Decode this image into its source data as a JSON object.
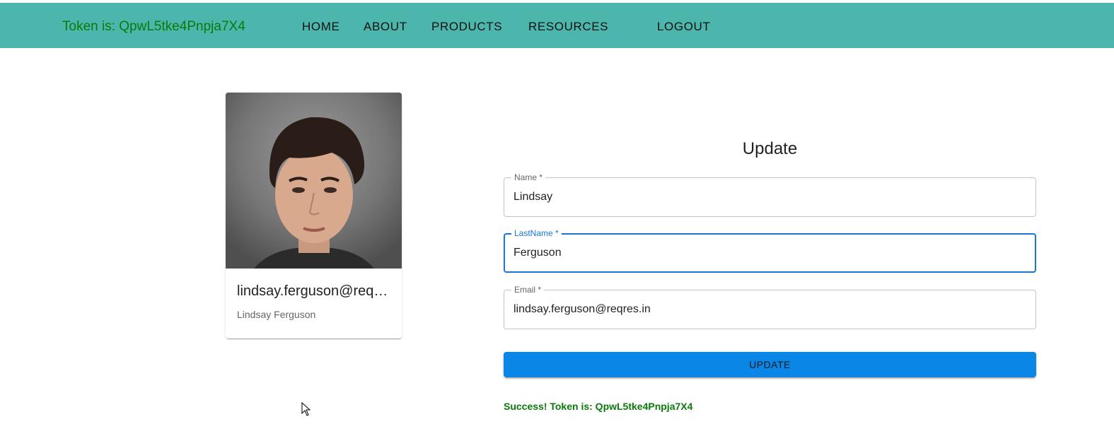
{
  "header": {
    "token_text": "Token is: QpwL5tke4Pnpja7X4",
    "nav": {
      "home": "HOME",
      "about": "ABOUT",
      "products": "PRODUCTS",
      "resources": "RESOURCES",
      "logout": "LOGOUT"
    },
    "background_color": "#4db6ac",
    "token_color": "#0a7a0a"
  },
  "profile_card": {
    "email": "lindsay.ferguson@reqres.in",
    "full_name": "Lindsay Ferguson",
    "avatar": "user-photo"
  },
  "form": {
    "title": "Update",
    "fields": [
      {
        "label": "Name *",
        "value": "Lindsay"
      },
      {
        "label": "LastName *",
        "value": "Ferguson"
      },
      {
        "label": "Email *",
        "value": "lindsay.ferguson@reqres.in"
      }
    ],
    "focus_color": "#1976d2",
    "submit_label": "UPDATE",
    "submit_color": "#0a87e6",
    "success_message": "Success! Token is: QpwL5tke4Pnpja7X4",
    "success_color": "#0a7a0a"
  },
  "icons": {
    "cursor": "mouse-pointer-icon"
  }
}
